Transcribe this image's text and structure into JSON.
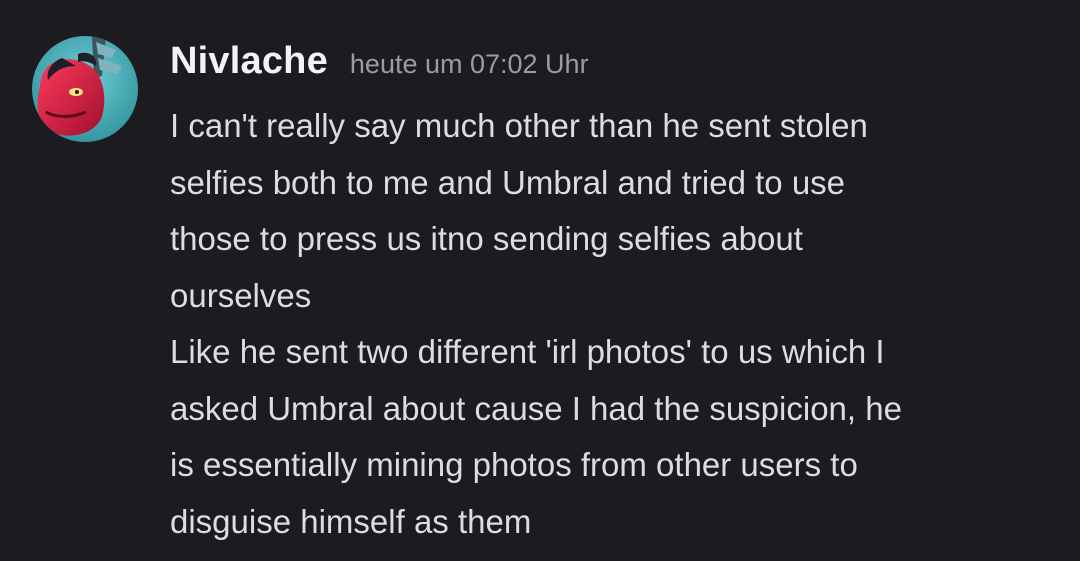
{
  "message": {
    "author": "Nivlache",
    "timestamp": "heute um 07:02 Uhr",
    "avatar_icon": "dragon-avatar-icon",
    "lines": [
      "I can't really say much other than he sent stolen",
      "selfies both to me and Umbral and tried to use",
      "those to press us itno sending selfies about",
      "ourselves",
      "Like he sent two different 'irl photos' to us which I",
      "asked Umbral about cause I had the suspicion, he",
      "is essentially mining photos from other users to",
      "disguise himself as them"
    ]
  },
  "colors": {
    "background": "#1b1b20",
    "username": "#f2f3f5",
    "timestamp": "#9a9ca4",
    "text": "#dcdde1"
  }
}
